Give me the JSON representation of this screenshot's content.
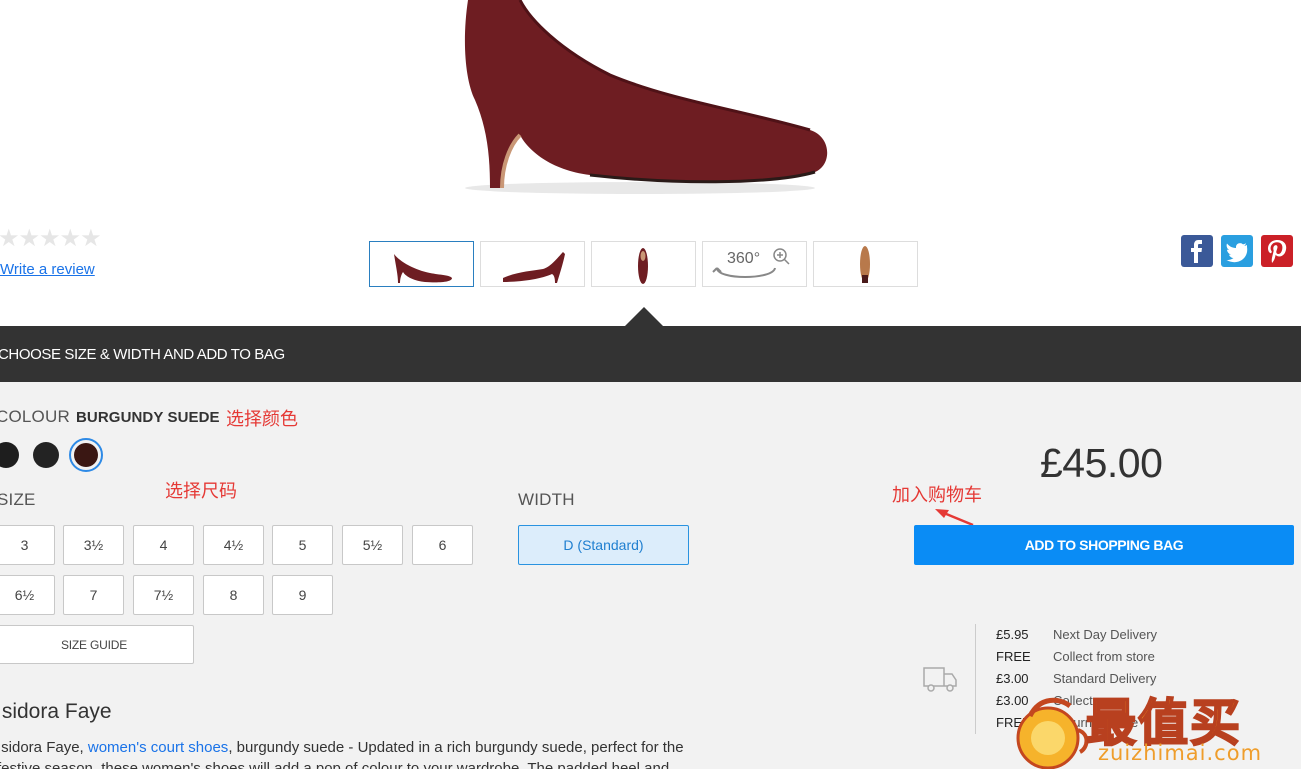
{
  "gallery": {
    "hero_image": "burgundy-suede-court-shoe",
    "rating_stars": "★★★★★",
    "write_review": "Write a review",
    "thumbnails": [
      {
        "name": "thumb-side-view",
        "active": true
      },
      {
        "name": "thumb-angle-view",
        "active": false
      },
      {
        "name": "thumb-top-view",
        "active": false
      },
      {
        "name": "thumb-360-view",
        "label": "360°",
        "active": false
      },
      {
        "name": "thumb-sole-view",
        "active": false
      }
    ],
    "social": [
      "facebook-icon",
      "twitter-icon",
      "pinterest-icon"
    ]
  },
  "bar": {
    "title": "CHOOSE SIZE & WIDTH AND ADD TO BAG"
  },
  "colour": {
    "label": "COLOUR",
    "value": "BURGUNDY SUEDE",
    "annotation": "选择颜色",
    "swatches": [
      "#1e1e1e",
      "#232323",
      "#3a1713"
    ]
  },
  "size": {
    "label": "SIZE",
    "annotation": "选择尺码",
    "options": [
      "3",
      "3½",
      "4",
      "4½",
      "5",
      "5½",
      "6",
      "6½",
      "7",
      "7½",
      "8",
      "9"
    ],
    "guide": "SIZE GUIDE"
  },
  "width": {
    "label": "WIDTH",
    "selected": "D (Standard)"
  },
  "purchase": {
    "price": "£45.00",
    "annotation": "加入购物车",
    "add_button": "ADD TO SHOPPING BAG",
    "accent": "#0a8cf5"
  },
  "delivery": [
    {
      "price": "£5.95",
      "desc": "Next Day Delivery"
    },
    {
      "price": "FREE",
      "desc": "Collect from store"
    },
    {
      "price": "£3.00",
      "desc": "Standard Delivery"
    },
    {
      "price": "£3.00",
      "desc": "Collect"
    },
    {
      "price": "FREE",
      "desc": "Return in store"
    }
  ],
  "product": {
    "name": "Isidora Faye",
    "desc_prefix": "Isidora Faye, ",
    "desc_link": "women's court shoes",
    "desc_rest": ", burgundy suede - Updated in a rich burgundy suede, perfect for the festive season, these women's shoes will add a pop of colour to your wardrobe. The padded heel and"
  },
  "watermark": {
    "main": "最值买",
    "sub": "zuizhimai.com"
  }
}
